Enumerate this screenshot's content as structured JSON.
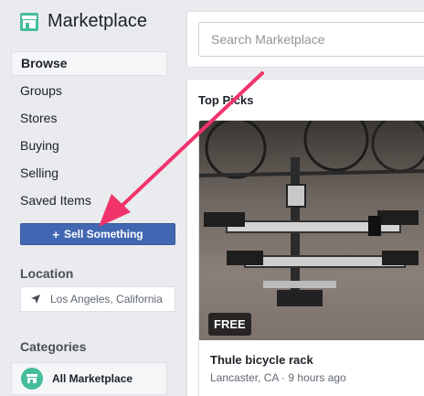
{
  "app": {
    "title": "Marketplace"
  },
  "sidebar": {
    "nav": [
      {
        "label": "Browse",
        "active": true
      },
      {
        "label": "Groups"
      },
      {
        "label": "Stores"
      },
      {
        "label": "Buying"
      },
      {
        "label": "Selling"
      },
      {
        "label": "Saved Items"
      }
    ],
    "sell_button": {
      "label": "Sell Something",
      "icon": "plus-icon"
    },
    "location": {
      "heading": "Location",
      "value": "Los Angeles, California",
      "icon": "location-arrow-icon"
    },
    "categories": {
      "heading": "Categories",
      "items": [
        {
          "label": "All Marketplace",
          "icon": "storefront-icon"
        }
      ]
    }
  },
  "search": {
    "placeholder": "Search Marketplace"
  },
  "main": {
    "section_title": "Top Picks",
    "item": {
      "title": "Thule bicycle rack",
      "price_badge": "FREE",
      "location": "Lancaster, CA",
      "posted": "9 hours ago",
      "photo": "bicycle-rack-photo"
    }
  },
  "colors": {
    "accent": "#4267b2",
    "annotation_arrow": "#f2336b",
    "category_icon": "#45bd9a",
    "background": "#e9ebee"
  }
}
